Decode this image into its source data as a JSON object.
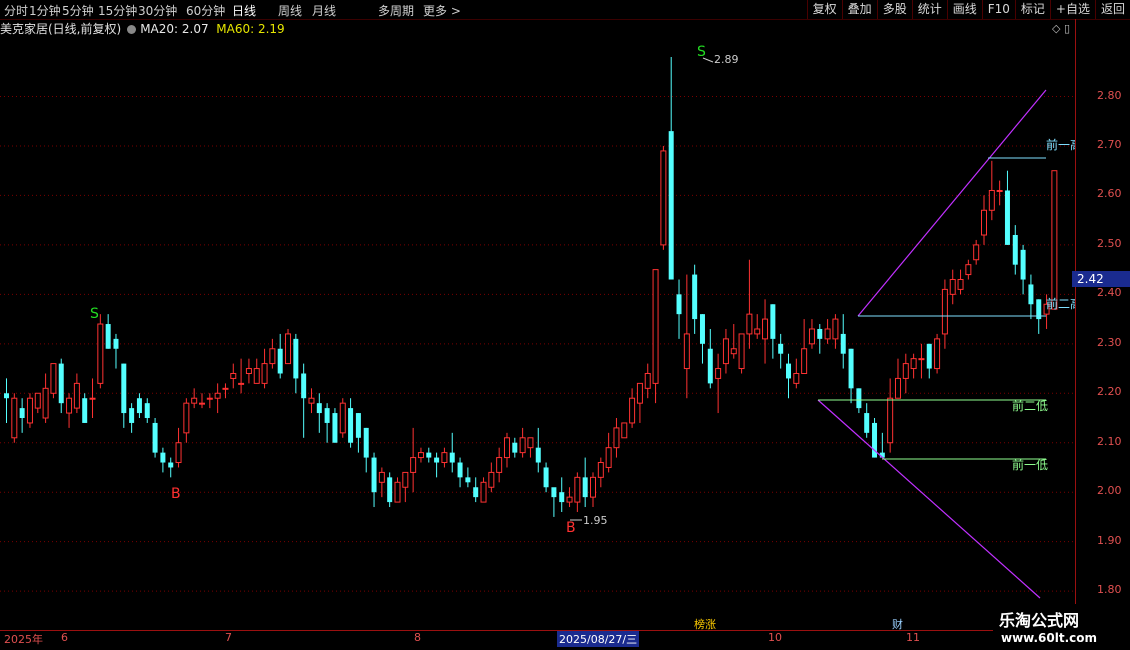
{
  "toolbar": {
    "periods": [
      "分时",
      "1分钟",
      "5分钟",
      "15分钟",
      "30分钟",
      "60分钟",
      "日线",
      "周线",
      "月线",
      "多周期",
      "更多 >"
    ],
    "active_period": "日线",
    "right_buttons": [
      "复权",
      "叠加",
      "多股",
      "统计",
      "画线",
      "F10",
      "标记",
      "+自选",
      "返回"
    ]
  },
  "info": {
    "stock": "美克家居(日线,前复权)",
    "ma20": "MA20: 2.07",
    "ma60": "MA60: 2.19"
  },
  "price_axis": {
    "labels": [
      "2.80",
      "2.70",
      "2.60",
      "2.50",
      "2.40",
      "2.30",
      "2.20",
      "2.10",
      "2.00",
      "1.90",
      "1.80"
    ],
    "current_price": "2.42"
  },
  "time_axis": {
    "labels": [
      "2025年",
      "6",
      "7",
      "8",
      "10",
      "11"
    ],
    "selected": "2025/08/27/三"
  },
  "annotations": {
    "high_price": "2.89",
    "low_price": "1.95",
    "sell_marker": "S",
    "buy_marker": "B",
    "prev_high1": "前一高",
    "prev_high2": "前二高",
    "prev_low2": "前二低",
    "prev_low1": "前一低"
  },
  "events": {
    "e1": "榜涨",
    "e2": "财"
  },
  "brand": {
    "name": "乐淘公式网",
    "url": "www.60lt.com"
  },
  "colors": {
    "up": "#ff3232",
    "down": "#54ffff",
    "grid": "#7a0000",
    "purple": "#c030ff",
    "hline": "#80e0ff",
    "greenline": "#90ff90"
  },
  "chart_data": {
    "type": "candlestick",
    "ylim": [
      1.8,
      2.89
    ],
    "candles": [
      [
        2.2,
        2.19,
        2.23,
        2.14
      ],
      [
        2.11,
        2.19,
        2.2,
        2.1
      ],
      [
        2.17,
        2.15,
        2.19,
        2.12
      ],
      [
        2.14,
        2.19,
        2.2,
        2.13
      ],
      [
        2.17,
        2.2,
        2.2,
        2.16
      ],
      [
        2.15,
        2.21,
        2.24,
        2.14
      ],
      [
        2.2,
        2.26,
        2.26,
        2.19
      ],
      [
        2.26,
        2.18,
        2.27,
        2.16
      ],
      [
        2.16,
        2.19,
        2.2,
        2.13
      ],
      [
        2.17,
        2.22,
        2.24,
        2.16
      ],
      [
        2.19,
        2.14,
        2.2,
        2.14
      ],
      [
        2.19,
        2.19,
        2.23,
        2.15
      ],
      [
        2.22,
        2.34,
        2.36,
        2.21
      ],
      [
        2.34,
        2.29,
        2.36,
        2.29
      ],
      [
        2.31,
        2.29,
        2.32,
        2.25
      ],
      [
        2.26,
        2.16,
        2.26,
        2.13
      ],
      [
        2.17,
        2.14,
        2.18,
        2.12
      ],
      [
        2.19,
        2.16,
        2.2,
        2.15
      ],
      [
        2.18,
        2.15,
        2.19,
        2.14
      ],
      [
        2.14,
        2.08,
        2.15,
        2.07
      ],
      [
        2.08,
        2.06,
        2.09,
        2.04
      ],
      [
        2.06,
        2.05,
        2.07,
        2.03
      ],
      [
        2.06,
        2.1,
        2.13,
        2.05
      ],
      [
        2.12,
        2.18,
        2.19,
        2.1
      ],
      [
        2.18,
        2.19,
        2.21,
        2.17
      ],
      [
        2.18,
        2.18,
        2.2,
        2.17
      ],
      [
        2.19,
        2.19,
        2.2,
        2.17
      ],
      [
        2.19,
        2.2,
        2.22,
        2.16
      ],
      [
        2.21,
        2.21,
        2.22,
        2.19
      ],
      [
        2.23,
        2.24,
        2.26,
        2.21
      ],
      [
        2.22,
        2.22,
        2.27,
        2.2
      ],
      [
        2.24,
        2.25,
        2.27,
        2.22
      ],
      [
        2.22,
        2.25,
        2.27,
        2.22
      ],
      [
        2.22,
        2.26,
        2.29,
        2.21
      ],
      [
        2.26,
        2.29,
        2.31,
        2.25
      ],
      [
        2.29,
        2.24,
        2.32,
        2.23
      ],
      [
        2.26,
        2.32,
        2.33,
        2.26
      ],
      [
        2.31,
        2.23,
        2.32,
        2.2
      ],
      [
        2.24,
        2.19,
        2.26,
        2.11
      ],
      [
        2.18,
        2.19,
        2.21,
        2.16
      ],
      [
        2.18,
        2.16,
        2.2,
        2.12
      ],
      [
        2.17,
        2.14,
        2.18,
        2.1
      ],
      [
        2.16,
        2.1,
        2.17,
        2.1
      ],
      [
        2.12,
        2.18,
        2.19,
        2.11
      ],
      [
        2.17,
        2.1,
        2.19,
        2.09
      ],
      [
        2.16,
        2.11,
        2.16,
        2.08
      ],
      [
        2.13,
        2.07,
        2.13,
        2.04
      ],
      [
        2.07,
        2.0,
        2.08,
        1.97
      ],
      [
        2.02,
        2.04,
        2.05,
        1.99
      ],
      [
        2.03,
        1.98,
        2.04,
        1.97
      ],
      [
        1.98,
        2.02,
        2.03,
        1.98
      ],
      [
        2.01,
        2.04,
        2.04,
        1.98
      ],
      [
        2.04,
        2.07,
        2.13,
        2.0
      ],
      [
        2.07,
        2.08,
        2.09,
        2.06
      ],
      [
        2.08,
        2.07,
        2.09,
        2.06
      ],
      [
        2.07,
        2.06,
        2.08,
        2.03
      ],
      [
        2.06,
        2.08,
        2.09,
        2.05
      ],
      [
        2.08,
        2.06,
        2.12,
        2.04
      ],
      [
        2.06,
        2.03,
        2.07,
        2.01
      ],
      [
        2.03,
        2.02,
        2.05,
        2.01
      ],
      [
        2.01,
        1.99,
        2.03,
        1.98
      ],
      [
        1.98,
        2.02,
        2.03,
        1.98
      ],
      [
        2.01,
        2.04,
        2.06,
        2.0
      ],
      [
        2.04,
        2.07,
        2.09,
        2.02
      ],
      [
        2.07,
        2.11,
        2.12,
        2.05
      ],
      [
        2.1,
        2.08,
        2.11,
        2.07
      ],
      [
        2.08,
        2.11,
        2.13,
        2.07
      ],
      [
        2.09,
        2.11,
        2.11,
        2.07
      ],
      [
        2.09,
        2.06,
        2.13,
        2.04
      ],
      [
        2.05,
        2.01,
        2.06,
        2.0
      ],
      [
        2.01,
        1.99,
        2.0,
        1.95
      ],
      [
        2.0,
        1.98,
        2.03,
        1.96
      ],
      [
        1.98,
        1.99,
        2.01,
        1.97
      ],
      [
        1.98,
        2.03,
        2.04,
        1.96
      ],
      [
        2.03,
        1.99,
        2.07,
        1.97
      ],
      [
        1.99,
        2.03,
        2.04,
        1.97
      ],
      [
        2.03,
        2.06,
        2.07,
        2.01
      ],
      [
        2.05,
        2.09,
        2.12,
        2.04
      ],
      [
        2.09,
        2.13,
        2.15,
        2.07
      ],
      [
        2.11,
        2.14,
        2.14,
        2.11
      ],
      [
        2.14,
        2.19,
        2.21,
        2.13
      ],
      [
        2.18,
        2.22,
        2.22,
        2.14
      ],
      [
        2.21,
        2.24,
        2.26,
        2.19
      ],
      [
        2.22,
        2.45,
        2.45,
        2.18
      ],
      [
        2.5,
        2.69,
        2.7,
        2.49
      ],
      [
        2.73,
        2.43,
        2.88,
        2.43
      ],
      [
        2.4,
        2.36,
        2.43,
        2.31
      ],
      [
        2.25,
        2.32,
        2.44,
        2.19
      ],
      [
        2.44,
        2.35,
        2.46,
        2.32
      ],
      [
        2.36,
        2.3,
        2.36,
        2.26
      ],
      [
        2.29,
        2.22,
        2.33,
        2.21
      ],
      [
        2.23,
        2.25,
        2.28,
        2.16
      ],
      [
        2.26,
        2.31,
        2.33,
        2.24
      ],
      [
        2.28,
        2.29,
        2.34,
        2.27
      ],
      [
        2.25,
        2.32,
        2.32,
        2.24
      ],
      [
        2.32,
        2.36,
        2.47,
        2.29
      ],
      [
        2.32,
        2.33,
        2.36,
        2.31
      ],
      [
        2.31,
        2.35,
        2.39,
        2.26
      ],
      [
        2.38,
        2.31,
        2.38,
        2.27
      ],
      [
        2.3,
        2.28,
        2.32,
        2.25
      ],
      [
        2.26,
        2.23,
        2.28,
        2.19
      ],
      [
        2.22,
        2.24,
        2.27,
        2.21
      ],
      [
        2.24,
        2.29,
        2.35,
        2.24
      ],
      [
        2.3,
        2.33,
        2.35,
        2.29
      ],
      [
        2.33,
        2.31,
        2.34,
        2.28
      ],
      [
        2.31,
        2.33,
        2.35,
        2.3
      ],
      [
        2.31,
        2.35,
        2.36,
        2.29
      ],
      [
        2.32,
        2.28,
        2.36,
        2.25
      ],
      [
        2.29,
        2.21,
        2.29,
        2.18
      ],
      [
        2.21,
        2.17,
        2.21,
        2.16
      ],
      [
        2.16,
        2.12,
        2.18,
        2.11
      ],
      [
        2.14,
        2.07,
        2.15,
        2.07
      ],
      [
        2.08,
        2.07,
        2.12,
        2.07
      ],
      [
        2.1,
        2.19,
        2.23,
        2.08
      ],
      [
        2.19,
        2.23,
        2.27,
        2.19
      ],
      [
        2.23,
        2.26,
        2.28,
        2.2
      ],
      [
        2.25,
        2.27,
        2.28,
        2.23
      ],
      [
        2.27,
        2.27,
        2.3,
        2.23
      ],
      [
        2.3,
        2.25,
        2.3,
        2.23
      ],
      [
        2.25,
        2.31,
        2.32,
        2.24
      ],
      [
        2.32,
        2.41,
        2.43,
        2.29
      ],
      [
        2.4,
        2.43,
        2.45,
        2.38
      ],
      [
        2.41,
        2.43,
        2.45,
        2.4
      ],
      [
        2.44,
        2.46,
        2.47,
        2.43
      ],
      [
        2.47,
        2.5,
        2.51,
        2.46
      ],
      [
        2.52,
        2.57,
        2.6,
        2.5
      ],
      [
        2.57,
        2.61,
        2.67,
        2.55
      ],
      [
        2.61,
        2.61,
        2.63,
        2.58
      ],
      [
        2.61,
        2.5,
        2.65,
        2.5
      ],
      [
        2.52,
        2.46,
        2.54,
        2.44
      ],
      [
        2.49,
        2.43,
        2.5,
        2.4
      ],
      [
        2.42,
        2.38,
        2.44,
        2.35
      ],
      [
        2.39,
        2.35,
        2.39,
        2.32
      ],
      [
        2.36,
        2.38,
        2.4,
        2.33
      ],
      [
        2.37,
        2.65,
        2.65,
        2.37
      ]
    ]
  }
}
